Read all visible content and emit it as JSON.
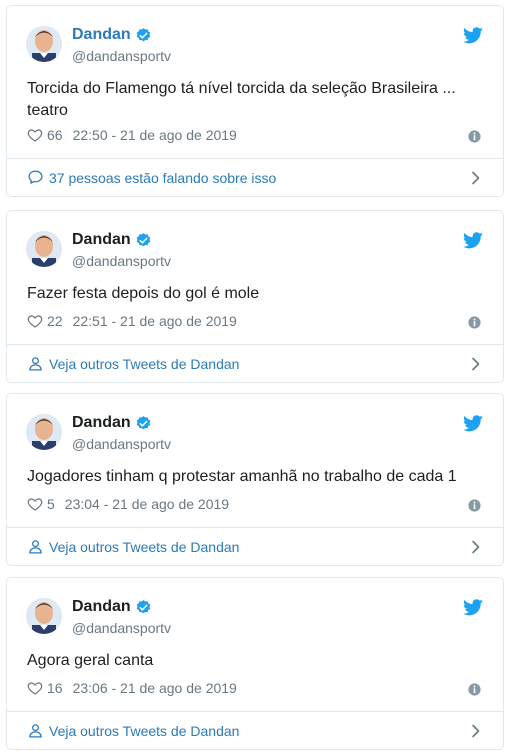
{
  "tweets": [
    {
      "author": "Dandan",
      "handle": "@dandansportv",
      "text": "Torcida do Flamengo tá nível torcida da seleção Brasileira ... teatro",
      "likes": "66",
      "time": "22:50 - 21 de ago de 2019",
      "footer": "37 pessoas estão falando sobre isso"
    },
    {
      "author": "Dandan",
      "handle": "@dandansportv",
      "text": "Fazer festa depois do gol é mole",
      "likes": "22",
      "time": "22:51 - 21 de ago de 2019",
      "footer": "Veja outros Tweets de Dandan"
    },
    {
      "author": "Dandan",
      "handle": "@dandansportv",
      "text": "Jogadores tinham q protestar amanhã no trabalho de cada 1",
      "likes": "5",
      "time": "23:04 - 21 de ago de 2019",
      "footer": "Veja outros Tweets de Dandan"
    },
    {
      "author": "Dandan",
      "handle": "@dandansportv",
      "text": "Agora geral canta",
      "likes": "16",
      "time": "23:06 - 21 de ago de 2019",
      "footer": "Veja outros Tweets de Dandan"
    }
  ],
  "colors": {
    "link": "#2b7bb9",
    "twitter_blue": "#1da1f2",
    "muted": "#697882",
    "border": "#e1e8ed"
  },
  "icons": {
    "verified": "verified-badge-icon",
    "bird": "twitter-bird-icon",
    "like": "heart-icon",
    "info": "info-icon",
    "conversation": "speech-bubble-icon",
    "profile": "person-icon",
    "chevron": "chevron-right-icon"
  }
}
